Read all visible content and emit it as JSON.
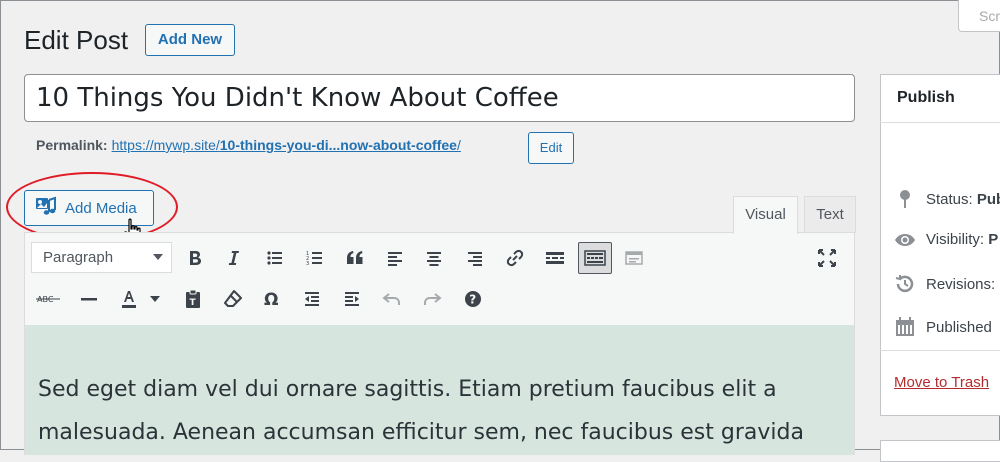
{
  "header": {
    "title": "Edit Post",
    "add_new_label": "Add New",
    "screen_options_label": "Scr"
  },
  "post": {
    "title_value": "10 Things You Didn't Know About Coffee"
  },
  "permalink": {
    "label": "Permalink:",
    "url_prefix": "https://mywp.site/",
    "url_slug": "10-things-you-di...now-about-coffee",
    "url_suffix": "/",
    "edit_label": "Edit"
  },
  "media": {
    "add_media_label": "Add Media"
  },
  "editor": {
    "tabs": [
      {
        "label": "Visual",
        "active": true
      },
      {
        "label": "Text",
        "active": false
      }
    ],
    "format_select_value": "Paragraph",
    "toolbar_row1": [
      "bold-icon",
      "italic-icon",
      "bullet-list-icon",
      "numbered-list-icon",
      "blockquote-icon",
      "align-left-icon",
      "align-center-icon",
      "align-right-icon",
      "link-icon",
      "read-more-icon",
      "toolbar-toggle-icon",
      "distraction-free-icon",
      "fullscreen-icon"
    ],
    "toolbar_row2": [
      "strikethrough-icon",
      "horizontal-line-icon",
      "text-color-icon",
      "paste-text-icon",
      "clear-formatting-icon",
      "special-character-icon",
      "outdent-icon",
      "indent-icon",
      "undo-icon",
      "redo-icon",
      "help-icon"
    ],
    "content_lines": [
      "Sed eget diam vel dui ornare sagittis. Etiam pretium faucibus elit a",
      "malesuada. Aenean accumsan efficitur sem, nec faucibus est gravida"
    ]
  },
  "publish_box": {
    "title": "Publish",
    "status_label": "Status:",
    "status_value": "Pub",
    "visibility_label": "Visibility:",
    "visibility_value": "P",
    "revisions_label": "Revisions:",
    "published_label": "Published",
    "move_to_trash_label": "Move to Trash"
  },
  "colors": {
    "accent": "#2271b1",
    "highlight": "#e01b24",
    "content_bg": "#d6e6df",
    "trash": "#b32d2e"
  }
}
